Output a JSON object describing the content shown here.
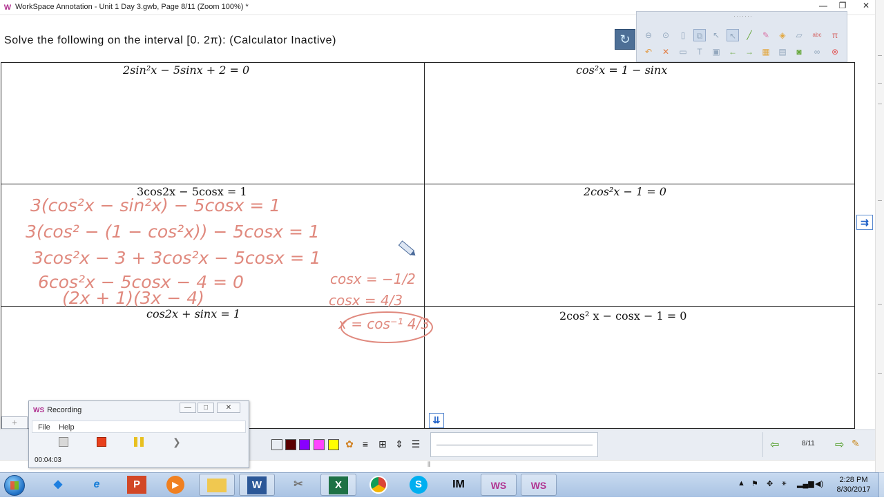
{
  "window": {
    "title": "WorkSpace Annotation - Unit 1 Day 3.gwb, Page 8/11  (Zoom 100%) *",
    "minimize": "—",
    "restore": "❐",
    "close": "✕"
  },
  "page": {
    "heading": "Solve the following on the interval [0. 2π): (Calculator Inactive)",
    "problems": [
      "2sin²x − 5sinx + 2 = 0",
      "cos²x = 1 − sinx",
      "3cos2x − 5cosx = 1",
      "2cos²x − 1 = 0",
      "cos2x + sinx = 1",
      "2cos² x − cosx − 1 = 0"
    ]
  },
  "handwriting": {
    "lines": [
      "3(cos²x − sin²x) − 5cosx = 1",
      "3(cos² − (1 − cos²x)) − 5cosx = 1",
      "3cos²x − 3 + 3cos²x − 5cosx = 1",
      "6cos²x − 5cosx − 4 = 0",
      "(2x + 1)(3x − 4)",
      "cosx = −1/2",
      "cosx = 4/3",
      "x = cos⁻¹ 4/3"
    ],
    "ink_color": "#e0897e"
  },
  "float_toolbar": {
    "grip": "·······",
    "icons_row1": [
      "minus-icon",
      "dropdown-icon",
      "mouse-icon",
      "copy-icon",
      "pointer-icon",
      "select-icon",
      "pen-icon",
      "highlighter-icon",
      "eraser-icon",
      "ruler-icon",
      "text-icon",
      "math-icon"
    ],
    "icons_row2": [
      "undo-icon",
      "delete-icon",
      "page-icon",
      "textbox-icon",
      "screenshot-icon",
      "back-icon",
      "forward-icon",
      "table-icon",
      "save-icon",
      "camera-icon",
      "link-icon",
      "close-icon"
    ]
  },
  "bottom_toolbar": {
    "colors": [
      "#ffffff",
      "#5a0000",
      "#8800ff",
      "#ff44ff",
      "#ffff00"
    ],
    "page_indicator": "8/11"
  },
  "recording": {
    "title": "Recording",
    "logo": "WS",
    "menu": [
      "File",
      "Help"
    ],
    "elapsed": "00:04:03",
    "minimize": "—",
    "maximize": "□",
    "close": "✕"
  },
  "taskbar": {
    "apps": [
      "Dropbox",
      "Internet Explorer",
      "PowerPoint",
      "Media Player",
      "File Explorer",
      "Word",
      "Snipping Tool",
      "Excel",
      "Chrome",
      "Skype",
      "IM",
      "WS",
      "WS"
    ],
    "clock": {
      "time": "2:28 PM",
      "date": "8/30/2017"
    }
  }
}
